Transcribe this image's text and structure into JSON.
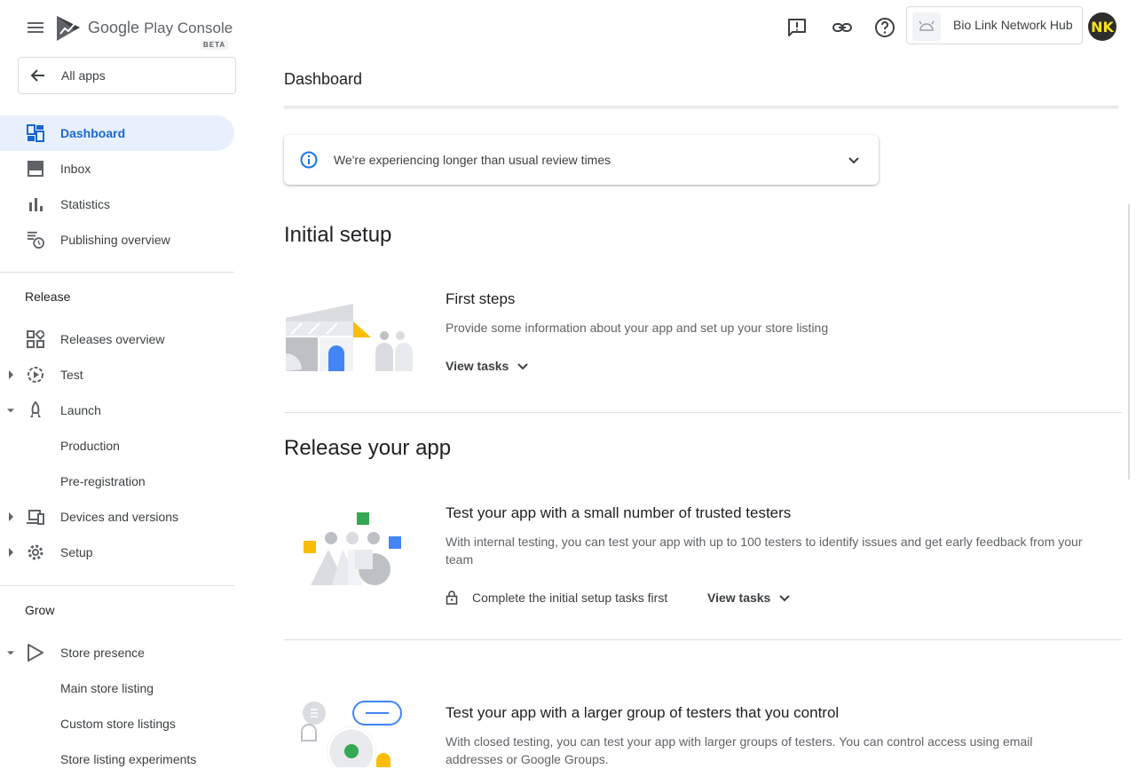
{
  "brand": {
    "name_part1": "Google",
    "name_part2": "Play Console",
    "badge": "BETA"
  },
  "sidebar": {
    "all_apps": "All apps",
    "items": [
      {
        "label": "Dashboard",
        "icon": "dashboard-icon"
      },
      {
        "label": "Inbox",
        "icon": "inbox-icon"
      },
      {
        "label": "Statistics",
        "icon": "bar-chart-icon"
      },
      {
        "label": "Publishing overview",
        "icon": "publishing-overview-icon"
      }
    ],
    "release_label": "Release",
    "release_items": [
      {
        "label": "Releases overview",
        "icon": "releases-overview-icon"
      },
      {
        "label": "Test",
        "icon": "test-icon"
      },
      {
        "label": "Launch",
        "icon": "launch-icon"
      },
      {
        "label": "Production"
      },
      {
        "label": "Pre-registration"
      },
      {
        "label": "Devices and versions",
        "icon": "devices-icon"
      },
      {
        "label": "Setup",
        "icon": "gear-icon"
      }
    ],
    "grow_label": "Grow",
    "grow_items": [
      {
        "label": "Store presence",
        "icon": "play-icon"
      },
      {
        "label": "Main store listing"
      },
      {
        "label": "Custom store listings"
      },
      {
        "label": "Store listing experiments"
      }
    ]
  },
  "topbar": {
    "app_name": "Bio Link Network Hub",
    "avatar_initials": "NK"
  },
  "main": {
    "title": "Dashboard",
    "notice": "We're experiencing longer than usual review times",
    "initial_setup": {
      "heading": "Initial setup",
      "card_title": "First steps",
      "card_desc": "Provide some information about your app and set up your store listing",
      "view_tasks": "View tasks"
    },
    "release": {
      "heading": "Release your app",
      "card1_title": "Test your app with a small number of trusted testers",
      "card1_desc": "With internal testing, you can test your app with up to 100 testers to identify issues and get early feedback from your team",
      "card1_lock": "Complete the initial setup tasks first",
      "card1_view_tasks": "View tasks",
      "card2_title": "Test your app with a larger group of testers that you control",
      "card2_desc": "With closed testing, you can test your app with larger groups of testers. You can control access using email addresses or Google Groups."
    }
  },
  "colors": {
    "accent": "#1967d2",
    "active_bg": "#e8f0fe",
    "green": "#34a853",
    "yellow": "#fbbc04",
    "blue": "#4285f4"
  }
}
